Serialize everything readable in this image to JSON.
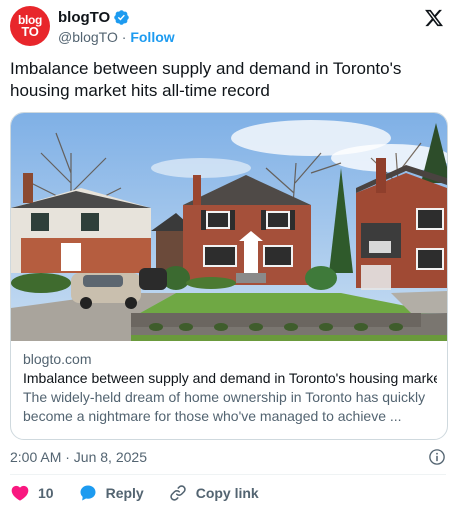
{
  "author": {
    "avatar_line1": "blog",
    "avatar_line2": "TO",
    "display_name": "blogTO",
    "handle": "@blogTO",
    "separator": "·",
    "follow_label": "Follow",
    "verified": true
  },
  "tweet": {
    "text": "Imbalance between supply and demand in Toronto's housing market hits all-time record"
  },
  "link_card": {
    "domain": "blogto.com",
    "title": "Imbalance between supply and demand in Toronto's housing marke...",
    "description": "The widely-held dream of home ownership in Toronto has quickly become a nightmare for those who've managed to achieve ..."
  },
  "meta": {
    "timestamp": "2:00 AM · Jun 8, 2025"
  },
  "actions": {
    "like_count": "10",
    "reply_label": "Reply",
    "copy_label": "Copy link"
  },
  "colors": {
    "brand_red": "#e8262b",
    "link_blue": "#1d9bf0",
    "like_pink": "#f91880",
    "muted_text": "#536471"
  },
  "icons": [
    "verified-badge-icon",
    "x-logo-icon",
    "info-icon",
    "heart-icon",
    "reply-bubble-icon",
    "link-icon"
  ]
}
